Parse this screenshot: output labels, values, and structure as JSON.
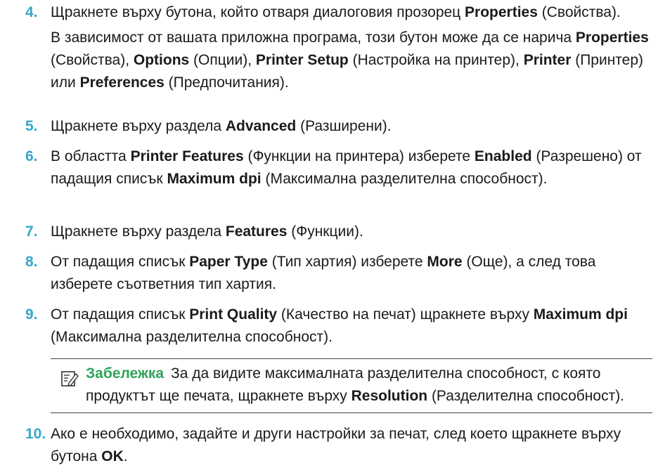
{
  "steps": [
    {
      "number": "4.",
      "parts": [
        {
          "t": "Щракнете върху бутона, който отваря диалоговия прозорец "
        },
        {
          "t": "Properties",
          "b": true
        },
        {
          "t": " (Свойства)."
        }
      ],
      "sub": [
        {
          "t": "В зависимост от вашата приложна програма, този бутон може да се нарича "
        },
        {
          "t": "Properties",
          "b": true
        },
        {
          "t": " (Свойства), "
        },
        {
          "t": "Options",
          "b": true
        },
        {
          "t": " (Опции), "
        },
        {
          "t": "Printer Setup",
          "b": true
        },
        {
          "t": " (Настройка на принтер), "
        },
        {
          "t": "Printer",
          "b": true
        },
        {
          "t": " (Принтер) или "
        },
        {
          "t": "Preferences",
          "b": true
        },
        {
          "t": " (Предпочитания)."
        }
      ]
    },
    {
      "number": "5.",
      "parts": [
        {
          "t": "Щракнете върху раздела "
        },
        {
          "t": "Advanced",
          "b": true
        },
        {
          "t": " (Разширени)."
        }
      ]
    },
    {
      "number": "6.",
      "parts": [
        {
          "t": "В областта "
        },
        {
          "t": "Printer Features",
          "b": true
        },
        {
          "t": " (Функции на принтера) изберете "
        },
        {
          "t": "Enabled",
          "b": true
        },
        {
          "t": " (Разрешено) от падащия списък "
        },
        {
          "t": "Maximum dpi",
          "b": true
        },
        {
          "t": " (Максимална разделителна способност)."
        }
      ]
    },
    {
      "number": "7.",
      "parts": [
        {
          "t": "Щракнете върху раздела "
        },
        {
          "t": "Features",
          "b": true
        },
        {
          "t": " (Функции)."
        }
      ]
    },
    {
      "number": "8.",
      "parts": [
        {
          "t": "От падащия списък "
        },
        {
          "t": "Paper Type",
          "b": true
        },
        {
          "t": " (Тип хартия) изберете "
        },
        {
          "t": "More",
          "b": true
        },
        {
          "t": " (Още), а след това изберете съответния тип хартия."
        }
      ]
    },
    {
      "number": "9.",
      "parts": [
        {
          "t": "От падащия списък "
        },
        {
          "t": "Print Quality",
          "b": true
        },
        {
          "t": " (Качество на печат) щракнете върху "
        },
        {
          "t": "Maximum dpi",
          "b": true
        },
        {
          "t": " (Максимална разделителна способност)."
        }
      ]
    },
    {
      "number": "10.",
      "parts": [
        {
          "t": "Ако е необходимо, задайте и други настройки за печат, след което щракнете върху бутона "
        },
        {
          "t": "OK",
          "b": true
        },
        {
          "t": "."
        }
      ]
    }
  ],
  "note": {
    "label": "Забележка",
    "parts": [
      {
        "t": "За да видите максималната разделителна способност, с която продуктът ще печата, щракнете върху "
      },
      {
        "t": "Resolution",
        "b": true
      },
      {
        "t": " (Разделителна способност)."
      }
    ]
  },
  "colors": {
    "step_number": "#35a8c9",
    "note_label": "#2fa35a"
  },
  "icons": {
    "note": "note-pencil-icon"
  }
}
